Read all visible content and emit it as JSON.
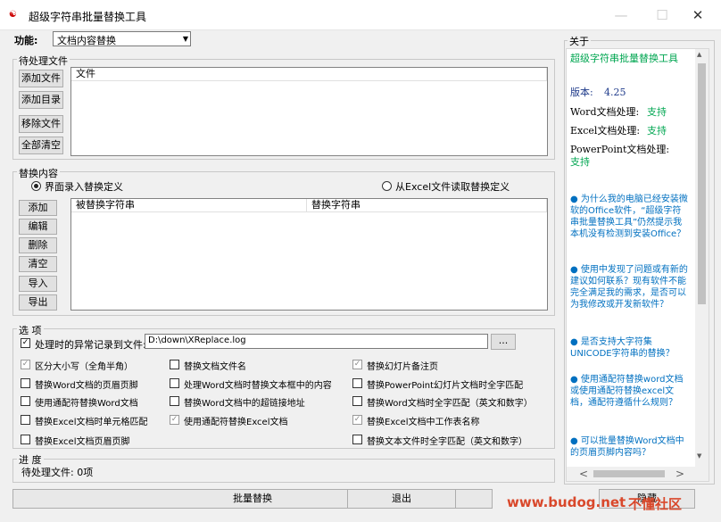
{
  "window": {
    "title": "超级字符串批量替换工具",
    "app_icon_glyph": "☯",
    "minimize_icon": "—",
    "maximize_icon": "☐",
    "close_icon": "✕"
  },
  "function": {
    "label": "功能:",
    "selected": "文档内容替换"
  },
  "pending_files": {
    "legend": "待处理文件",
    "buttons": {
      "add_file": "添加文件",
      "add_dir": "添加目录",
      "remove_file": "移除文件",
      "clear_all": "全部清空"
    },
    "column_file": "文件"
  },
  "replace_content": {
    "legend": "替换内容",
    "mode_ui": "界面录入替换定义",
    "mode_excel": "从Excel文件读取替换定义",
    "buttons": {
      "add": "添加",
      "edit": "编辑",
      "delete": "删除",
      "clear": "清空",
      "import": "导入",
      "export": "导出"
    },
    "columns": {
      "source": "被替换字符串",
      "target": "替换字符串"
    }
  },
  "options": {
    "legend": "选 项",
    "log_label": "处理时的异常记录到文件:",
    "log_path": "D:\\down\\XReplace.log",
    "browse": "...",
    "items": [
      {
        "label": "区分大小写（全角半角）",
        "checked": true
      },
      {
        "label": "替换文档文件名",
        "checked": false
      },
      {
        "label": "替换幻灯片备注页",
        "checked": true
      },
      {
        "label": "替换Word文档的页眉页脚",
        "checked": false
      },
      {
        "label": "处理Word文档时替换文本框中的内容",
        "checked": false
      },
      {
        "label": "替换PowerPoint幻灯片文档时全字匹配",
        "checked": false
      },
      {
        "label": "使用通配符替换Word文档",
        "checked": false
      },
      {
        "label": "替换Word文档中的超链接地址",
        "checked": false
      },
      {
        "label": "替换Word文档时全字匹配（英文和数字）",
        "checked": false
      },
      {
        "label": "替换Excel文档时单元格匹配",
        "checked": false
      },
      {
        "label": "使用通配符替换Excel文档",
        "checked": true
      },
      {
        "label": "替换Excel文档中工作表名称",
        "checked": true
      },
      {
        "label": "替换Excel文档页眉页脚",
        "checked": false
      },
      {
        "label": "替换文本文件时全字匹配（英文和数字）",
        "checked": false
      }
    ]
  },
  "progress": {
    "legend": "进 度",
    "status": "待处理文件: 0项"
  },
  "actions": {
    "batch_replace": "批量替换",
    "exit": "退出",
    "hide": "隐藏"
  },
  "about": {
    "legend": "关于",
    "product_name": "超级字符串批量替换工具",
    "version_label": "版本:",
    "version": "4.25",
    "word_label": "Word文档处理:",
    "word_status": "支持",
    "excel_label": "Excel文档处理:",
    "excel_status": "支持",
    "ppt_label": "PowerPoint文档处理:",
    "ppt_status": "支持",
    "faq": [
      "● 为什么我的电脑已经安装微软的Office软件，“超级字符串批量替换工具”仍然提示我本机没有检测到安装Office？",
      "● 使用中发现了问题或有新的建议如何联系？现有软件不能完全满足我的需求，是否可以为我修改或开发新软件？",
      "● 是否支持大字符集UNICODE字符串的替换？",
      "● 使用通配符替换word文档或使用通配符替换excel文档，通配符遵循什么规则？",
      "● 可以批量替换Word文档中的页眉页脚内容吗？"
    ],
    "scroll_left": "<",
    "scroll_right": ">",
    "scroll_up": "▲",
    "scroll_down": "▼"
  },
  "watermark": {
    "url": "www.budog.net",
    "site": "不懂社区"
  },
  "colors": {
    "status_green": "#00a651",
    "link_blue": "#0070c0",
    "version_blue": "#1e3a8a"
  }
}
